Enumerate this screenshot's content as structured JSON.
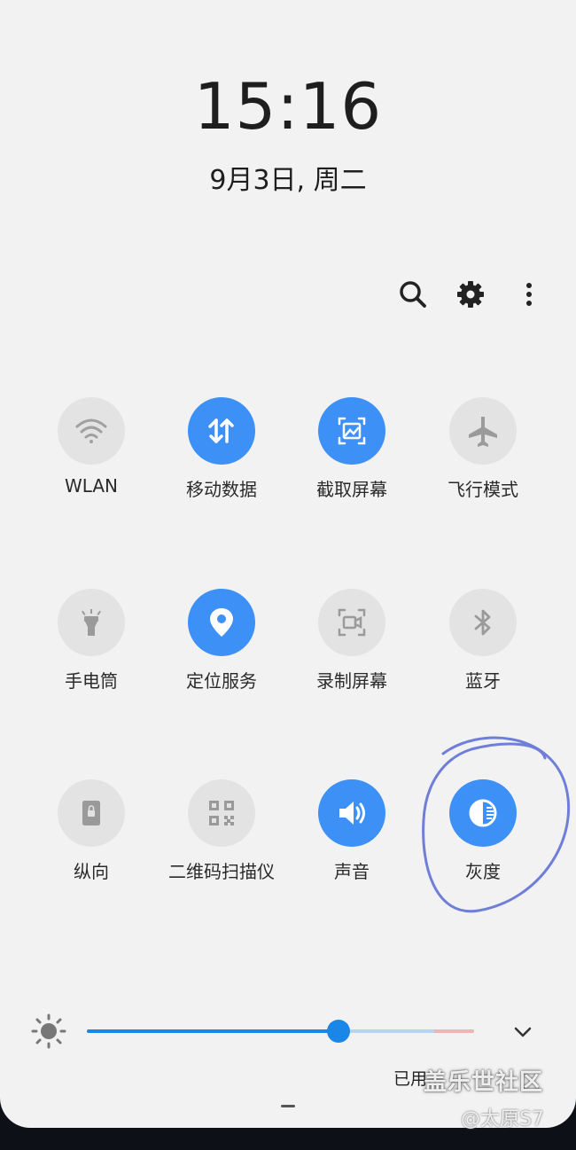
{
  "clock": {
    "time": "15:16",
    "date": "9月3日, 周二"
  },
  "toolbar": {
    "icons": [
      "search-icon",
      "gear-icon",
      "more-vert-icon"
    ]
  },
  "tiles": [
    {
      "label": "WLAN",
      "icon": "wifi-icon",
      "active": false
    },
    {
      "label": "移动数据",
      "icon": "mobile-data-icon",
      "active": true
    },
    {
      "label": "截取屏幕",
      "icon": "screenshot-icon",
      "active": true
    },
    {
      "label": "飞行模式",
      "icon": "airplane-icon",
      "active": false
    },
    {
      "label": "手电筒",
      "icon": "flashlight-icon",
      "active": false
    },
    {
      "label": "定位服务",
      "icon": "location-icon",
      "active": true
    },
    {
      "label": "录制屏幕",
      "icon": "screen-record-icon",
      "active": false
    },
    {
      "label": "蓝牙",
      "icon": "bluetooth-icon",
      "active": false
    },
    {
      "label": "纵向",
      "icon": "portrait-lock-icon",
      "active": false
    },
    {
      "label": "二维码扫描仪",
      "icon": "qr-scanner-icon",
      "active": false
    },
    {
      "label": "声音",
      "icon": "sound-icon",
      "active": true
    },
    {
      "label": "灰度",
      "icon": "grayscale-icon",
      "active": true
    }
  ],
  "brightness": {
    "level": 0.65,
    "icon": "sun-icon",
    "expand_icon": "chevron-down-icon"
  },
  "storage": {
    "text": "已用..."
  },
  "watermark": {
    "line1": "盖乐世社区",
    "line2": "@太原S7"
  },
  "colors": {
    "accent": "#3d90f6",
    "inactive": "#e3e3e3",
    "background": "#f2f2f2",
    "annotation": "#6f7fd8"
  }
}
